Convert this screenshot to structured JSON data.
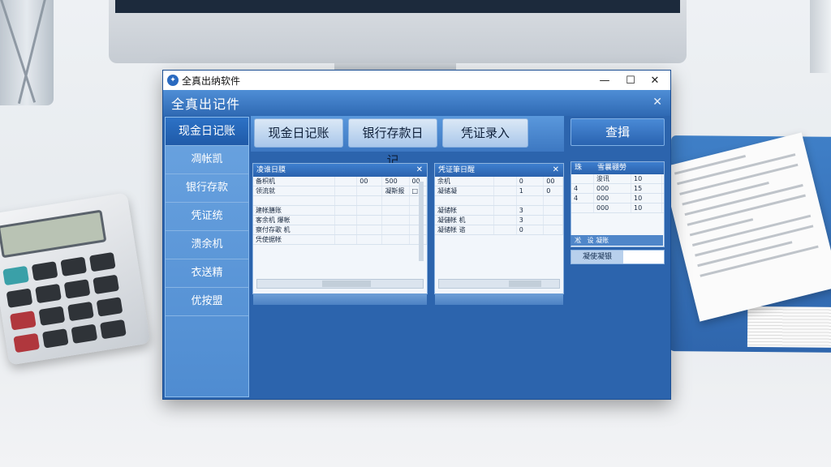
{
  "window": {
    "title": "全真出纳软件",
    "controls": {
      "minimize": "—",
      "maximize": "☐",
      "close": "✕"
    }
  },
  "header": {
    "title": "全真出记件",
    "close": "✕"
  },
  "sidebar": {
    "items": [
      {
        "label": "现金日记账",
        "active": true
      },
      {
        "label": "凋帐凯"
      },
      {
        "label": "银行存款"
      },
      {
        "label": "凭证统"
      },
      {
        "label": "溃余机"
      },
      {
        "label": "衣送精"
      },
      {
        "label": "优按盟"
      }
    ]
  },
  "tabs": [
    {
      "label": "现金日记账"
    },
    {
      "label": "银行存款日记"
    },
    {
      "label": "凭证录入"
    }
  ],
  "panel_left": {
    "title": "凌谁日膜",
    "rows": [
      [
        "备枳机",
        "",
        "00",
        "500",
        "00"
      ],
      [
        "领流就",
        "",
        "",
        "凝斯报",
        "□"
      ],
      [
        "",
        "",
        "",
        "",
        ""
      ],
      [
        "建帐膳账",
        "",
        "",
        "",
        ""
      ],
      [
        "客余机 爆帐",
        "",
        "",
        "",
        ""
      ],
      [
        "察付存歌 机",
        "",
        "",
        "",
        ""
      ],
      [
        "凭使据帐",
        "",
        "",
        "",
        ""
      ]
    ]
  },
  "panel_right": {
    "title": "凭证筆日醒",
    "rows": [
      [
        "余机",
        "",
        "0",
        "00"
      ],
      [
        "凝储凝",
        "",
        "1",
        "0"
      ],
      [
        "",
        "",
        "",
        ""
      ],
      [
        "凝储帐",
        "",
        "3",
        ""
      ],
      [
        "凝儲帐 机",
        "",
        "3",
        ""
      ],
      [
        "凝储帐 谘",
        "",
        "0",
        ""
      ]
    ]
  },
  "query_button": {
    "label": "查揖"
  },
  "summary": {
    "headers": [
      "珠",
      "雪曩硼勞"
    ],
    "rows": [
      [
        "",
        "浚讯",
        "10"
      ],
      [
        "4",
        "000",
        "15"
      ],
      [
        "4",
        "000",
        "10"
      ],
      [
        "",
        "000",
        "10"
      ]
    ],
    "footer": [
      "凇",
      "设 凝账"
    ],
    "input_label": "凝使凝银",
    "input_value": ""
  }
}
